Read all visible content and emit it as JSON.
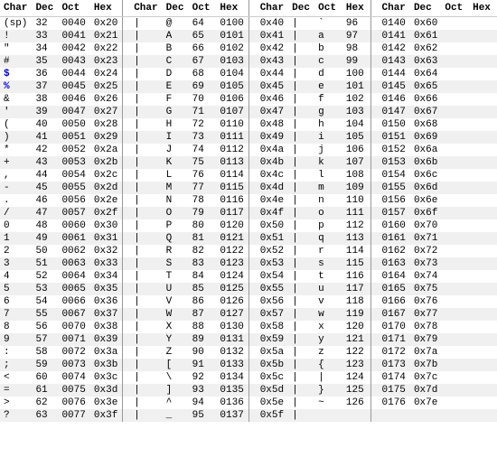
{
  "table": {
    "headers": [
      "Char",
      "Dec",
      "Oct",
      "Hex",
      "|",
      "Char",
      "Dec",
      "Oct",
      "Hex",
      "|",
      "Char",
      "Dec",
      "Oct",
      "Hex",
      "|",
      "Char",
      "Dec",
      "Oct",
      "Hex"
    ],
    "rows": [
      [
        "(sp)",
        "32",
        "0040",
        "0x20",
        "|",
        "@",
        "64",
        "0100",
        "0x40",
        "|",
        "`",
        "96",
        "0140",
        "0x60"
      ],
      [
        "!",
        "33",
        "0041",
        "0x21",
        "|",
        "A",
        "65",
        "0101",
        "0x41",
        "|",
        "a",
        "97",
        "0141",
        "0x61"
      ],
      [
        "\"",
        "34",
        "0042",
        "0x22",
        "|",
        "B",
        "66",
        "0102",
        "0x42",
        "|",
        "b",
        "98",
        "0142",
        "0x62"
      ],
      [
        "#",
        "35",
        "0043",
        "0x23",
        "|",
        "C",
        "67",
        "0103",
        "0x43",
        "|",
        "c",
        "99",
        "0143",
        "0x63"
      ],
      [
        "$",
        "36",
        "0044",
        "0x24",
        "|",
        "D",
        "68",
        "0104",
        "0x44",
        "|",
        "d",
        "100",
        "0144",
        "0x64"
      ],
      [
        "%",
        "37",
        "0045",
        "0x25",
        "|",
        "E",
        "69",
        "0105",
        "0x45",
        "|",
        "e",
        "101",
        "0145",
        "0x65"
      ],
      [
        "&",
        "38",
        "0046",
        "0x26",
        "|",
        "F",
        "70",
        "0106",
        "0x46",
        "|",
        "f",
        "102",
        "0146",
        "0x66"
      ],
      [
        "'",
        "39",
        "0047",
        "0x27",
        "|",
        "G",
        "71",
        "0107",
        "0x47",
        "|",
        "g",
        "103",
        "0147",
        "0x67"
      ],
      [
        "(",
        "40",
        "0050",
        "0x28",
        "|",
        "H",
        "72",
        "0110",
        "0x48",
        "|",
        "h",
        "104",
        "0150",
        "0x68"
      ],
      [
        ")",
        "41",
        "0051",
        "0x29",
        "|",
        "I",
        "73",
        "0111",
        "0x49",
        "|",
        "i",
        "105",
        "0151",
        "0x69"
      ],
      [
        "*",
        "42",
        "0052",
        "0x2a",
        "|",
        "J",
        "74",
        "0112",
        "0x4a",
        "|",
        "j",
        "106",
        "0152",
        "0x6a"
      ],
      [
        "+",
        "43",
        "0053",
        "0x2b",
        "|",
        "K",
        "75",
        "0113",
        "0x4b",
        "|",
        "k",
        "107",
        "0153",
        "0x6b"
      ],
      [
        ",",
        "44",
        "0054",
        "0x2c",
        "|",
        "L",
        "76",
        "0114",
        "0x4c",
        "|",
        "l",
        "108",
        "0154",
        "0x6c"
      ],
      [
        "-",
        "45",
        "0055",
        "0x2d",
        "|",
        "M",
        "77",
        "0115",
        "0x4d",
        "|",
        "m",
        "109",
        "0155",
        "0x6d"
      ],
      [
        ".",
        "46",
        "0056",
        "0x2e",
        "|",
        "N",
        "78",
        "0116",
        "0x4e",
        "|",
        "n",
        "110",
        "0156",
        "0x6e"
      ],
      [
        "/",
        "47",
        "0057",
        "0x2f",
        "|",
        "O",
        "79",
        "0117",
        "0x4f",
        "|",
        "o",
        "111",
        "0157",
        "0x6f"
      ],
      [
        "0",
        "48",
        "0060",
        "0x30",
        "|",
        "P",
        "80",
        "0120",
        "0x50",
        "|",
        "p",
        "112",
        "0160",
        "0x70"
      ],
      [
        "1",
        "49",
        "0061",
        "0x31",
        "|",
        "Q",
        "81",
        "0121",
        "0x51",
        "|",
        "q",
        "113",
        "0161",
        "0x71"
      ],
      [
        "2",
        "50",
        "0062",
        "0x32",
        "|",
        "R",
        "82",
        "0122",
        "0x52",
        "|",
        "r",
        "114",
        "0162",
        "0x72"
      ],
      [
        "3",
        "51",
        "0063",
        "0x33",
        "|",
        "S",
        "83",
        "0123",
        "0x53",
        "|",
        "s",
        "115",
        "0163",
        "0x73"
      ],
      [
        "4",
        "52",
        "0064",
        "0x34",
        "|",
        "T",
        "84",
        "0124",
        "0x54",
        "|",
        "t",
        "116",
        "0164",
        "0x74"
      ],
      [
        "5",
        "53",
        "0065",
        "0x35",
        "|",
        "U",
        "85",
        "0125",
        "0x55",
        "|",
        "u",
        "117",
        "0165",
        "0x75"
      ],
      [
        "6",
        "54",
        "0066",
        "0x36",
        "|",
        "V",
        "86",
        "0126",
        "0x56",
        "|",
        "v",
        "118",
        "0166",
        "0x76"
      ],
      [
        "7",
        "55",
        "0067",
        "0x37",
        "|",
        "W",
        "87",
        "0127",
        "0x57",
        "|",
        "w",
        "119",
        "0167",
        "0x77"
      ],
      [
        "8",
        "56",
        "0070",
        "0x38",
        "|",
        "X",
        "88",
        "0130",
        "0x58",
        "|",
        "x",
        "120",
        "0170",
        "0x78"
      ],
      [
        "9",
        "57",
        "0071",
        "0x39",
        "|",
        "Y",
        "89",
        "0131",
        "0x59",
        "|",
        "y",
        "121",
        "0171",
        "0x79"
      ],
      [
        ":",
        "58",
        "0072",
        "0x3a",
        "|",
        "Z",
        "90",
        "0132",
        "0x5a",
        "|",
        "z",
        "122",
        "0172",
        "0x7a"
      ],
      [
        ";",
        "59",
        "0073",
        "0x3b",
        "|",
        "[",
        "91",
        "0133",
        "0x5b",
        "|",
        "{",
        "123",
        "0173",
        "0x7b"
      ],
      [
        "<",
        "60",
        "0074",
        "0x3c",
        "|",
        "\\",
        "92",
        "0134",
        "0x5c",
        "|",
        "|",
        "124",
        "0174",
        "0x7c"
      ],
      [
        "=",
        "61",
        "0075",
        "0x3d",
        "|",
        "]",
        "93",
        "0135",
        "0x5d",
        "|",
        "}",
        "125",
        "0175",
        "0x7d"
      ],
      [
        ">",
        "62",
        "0076",
        "0x3e",
        "|",
        "^",
        "94",
        "0136",
        "0x5e",
        "|",
        "~",
        "126",
        "0176",
        "0x7e"
      ],
      [
        "?",
        "63",
        "0077",
        "0x3f",
        "|",
        "_",
        "95",
        "0137",
        "0x5f",
        "|",
        "",
        "",
        "",
        ""
      ]
    ]
  }
}
